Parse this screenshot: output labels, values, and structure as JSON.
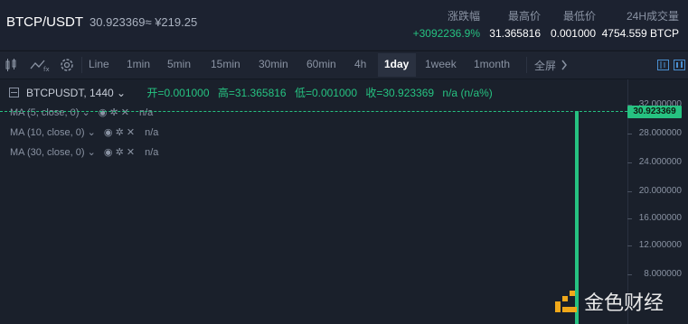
{
  "header": {
    "pair": "BTCP/USDT",
    "price": "30.923369≈ ¥219.25",
    "stats": [
      {
        "label": "涨跌幅",
        "value": "+3092236.9%",
        "positive": true
      },
      {
        "label": "最高价",
        "value": "31.365816"
      },
      {
        "label": "最低价",
        "value": "0.001000"
      },
      {
        "label": "24H成交量",
        "value": "4754.559 BTCP"
      }
    ]
  },
  "toolbar": {
    "timeframes": [
      "Line",
      "1min",
      "5min",
      "15min",
      "30min",
      "60min",
      "4h",
      "1day",
      "1week",
      "1month"
    ],
    "active": "1day",
    "fullscreen": "全屏",
    "icons": [
      "candlestick-icon",
      "indicator-icon",
      "settings-gear-icon",
      "chevron-right-icon",
      "chart-type-icon-1",
      "chart-type-icon-2"
    ]
  },
  "chart": {
    "symbol": "BTCPUSDT, 1440",
    "open": "开=0.001000",
    "high": "高=31.365816",
    "low": "低=0.001000",
    "close": "收=30.923369",
    "change": "n/a (n/a%)",
    "ma": [
      {
        "label": "MA (5, close, 0)",
        "value": "n/a"
      },
      {
        "label": "MA (10, close, 0)",
        "value": "n/a"
      },
      {
        "label": "MA (30, close, 0)",
        "value": "n/a"
      }
    ],
    "y_ticks": [
      "32.000000",
      "28.000000",
      "24.000000",
      "20.000000",
      "16.000000",
      "12.000000",
      "8.000000"
    ],
    "last_price": "30.923369",
    "accent": "#26c281"
  },
  "watermark": {
    "text": "金色财经"
  }
}
